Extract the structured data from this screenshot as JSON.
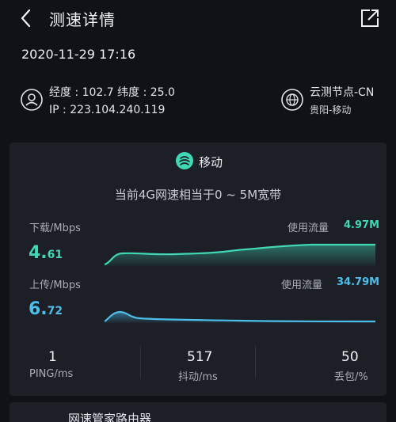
{
  "header": {
    "title": "测速详情"
  },
  "datetime": "2020-11-29 17:16",
  "location": {
    "coords": "经度 : 102.7  纬度 : 25.0",
    "ip": "IP : 223.104.240.119"
  },
  "node": {
    "name": "云测节点-CN",
    "region": "贵阳-移动"
  },
  "operator": "移动",
  "bandwidth_note": "当前4G网速相当于0 ~ 5M宽带",
  "download": {
    "label": "下载/Mbps",
    "speed_int": "4.",
    "speed_dec": "61",
    "usage_label": "使用流量",
    "usage_value": "4.97M",
    "color": "#3fd7b4"
  },
  "upload": {
    "label": "上传/Mbps",
    "speed_int": "6.",
    "speed_dec": "72",
    "usage_label": "使用流量",
    "usage_value": "34.79M",
    "color": "#4dbde9"
  },
  "stats": {
    "ping": {
      "value": "1",
      "label": "PING/ms"
    },
    "jitter": {
      "value": "517",
      "label": "抖动/ms"
    },
    "loss": {
      "value": "50",
      "label": "丢包/%"
    }
  },
  "next_card": {
    "title": "网速管家路由器"
  }
}
